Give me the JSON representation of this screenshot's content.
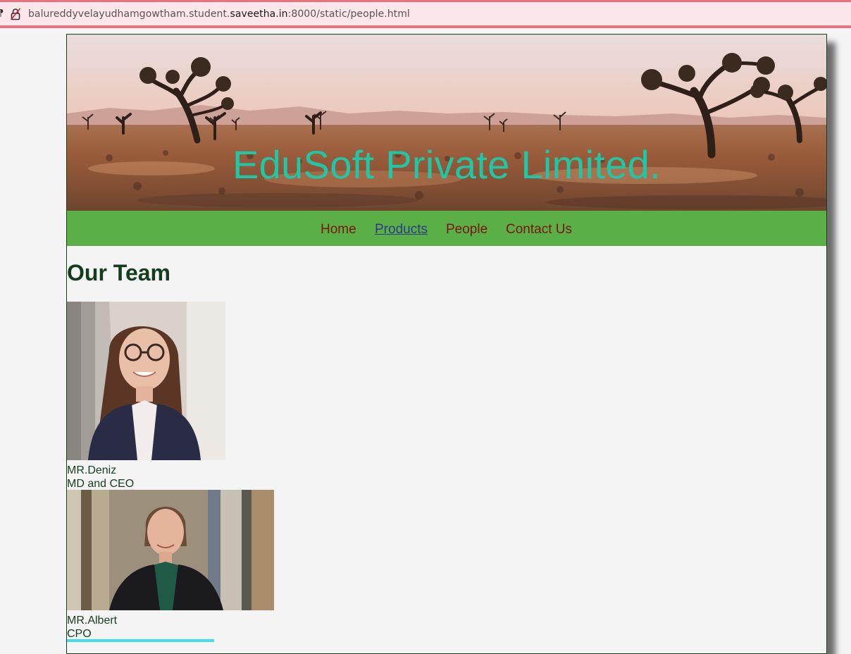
{
  "browser": {
    "url_prefix": "balureddyvelayudhamgowtham.student.",
    "url_domain": "saveetha.in",
    "url_suffix": ":8000/static/people.html"
  },
  "header": {
    "title": "EduSoft Private Limited."
  },
  "nav": {
    "items": [
      {
        "label": "Home"
      },
      {
        "label": "Products"
      },
      {
        "label": "People"
      },
      {
        "label": "Contact Us"
      }
    ]
  },
  "main": {
    "heading": "Our Team",
    "members": [
      {
        "name": "MR.Deniz",
        "role": "MD and CEO"
      },
      {
        "name": "MR.Albert",
        "role": "CPO"
      }
    ]
  },
  "colors": {
    "title": "#1fc7a6",
    "navbar": "#5aaf47",
    "nav_link": "#7a1508",
    "nav_active": "#2f3a8a",
    "heading": "#143d1d",
    "address_bar_accent": "#e8737f"
  }
}
